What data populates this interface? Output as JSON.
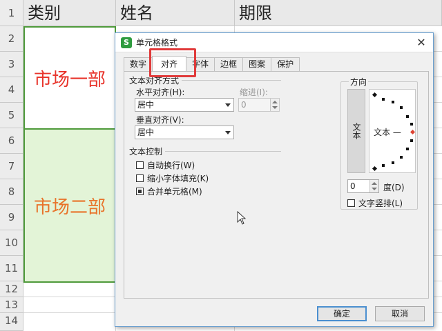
{
  "sheet": {
    "columns": [
      "类别",
      "姓名",
      "期限"
    ],
    "rows": [
      "1",
      "2",
      "3",
      "4",
      "5",
      "6",
      "7",
      "8",
      "9",
      "10",
      "11",
      "12",
      "13",
      "14"
    ],
    "merged_cells": [
      {
        "text": "市场一部",
        "color": "#e8332a",
        "background": "#ffffff"
      },
      {
        "text": "市场二部",
        "color": "#e8732a",
        "background": "#e3f4d7"
      }
    ]
  },
  "dialog": {
    "title": "单元格格式",
    "tabs": [
      "数字",
      "对齐",
      "字体",
      "边框",
      "图案",
      "保护"
    ],
    "active_tab": "对齐",
    "text_alignment": {
      "group_title": "文本对齐方式",
      "horizontal_label": "水平对齐(H):",
      "horizontal_value": "居中",
      "indent_label": "缩进(I):",
      "indent_value": "0",
      "vertical_label": "垂直对齐(V):",
      "vertical_value": "居中"
    },
    "text_control": {
      "group_title": "文本控制",
      "options": [
        {
          "label": "自动换行(W)",
          "checked": false
        },
        {
          "label": "缩小字体填充(K)",
          "checked": false
        },
        {
          "label": "合并单元格(M)",
          "checked": true
        }
      ]
    },
    "orientation": {
      "group_title": "方向",
      "vertical_text_button": "文本",
      "dial_label": "文本 —",
      "degree_value": "0",
      "degree_label": "度(D)",
      "vertical_text_checkbox": "文字竖排(L)",
      "vertical_text_checked": false
    },
    "ok_label": "确定",
    "cancel_label": "取消"
  }
}
